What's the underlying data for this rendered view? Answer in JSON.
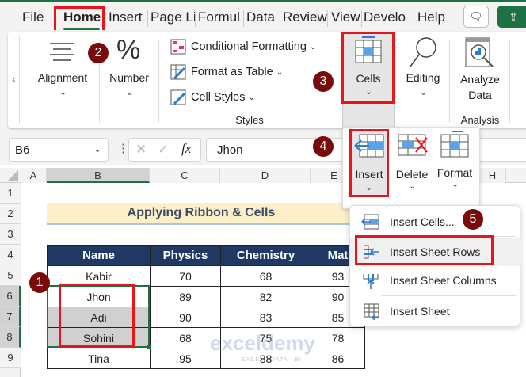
{
  "tabs": [
    "File",
    "Home",
    "Insert",
    "Page Li",
    "Formul",
    "Data",
    "Review",
    "View",
    "Develo",
    "Help"
  ],
  "ribbon": {
    "alignment": "Alignment",
    "number": "Number",
    "conditional_formatting": "Conditional Formatting",
    "format_as_table": "Format as Table",
    "cell_styles": "Cell Styles",
    "styles_group": "Styles",
    "cells": "Cells",
    "editing": "Editing",
    "analyze_data": "Analyze",
    "analyze_data2": "Data",
    "analysis_group": "Analysis",
    "scroll_left": "‹"
  },
  "formula_bar": {
    "name_box": "B6",
    "formula": "Jhon",
    "fx": "fx"
  },
  "columns": [
    "A",
    "B",
    "C",
    "D",
    "E",
    "H"
  ],
  "rows": [
    "1",
    "2",
    "3",
    "4",
    "5",
    "6",
    "7",
    "8",
    "9"
  ],
  "title": "Applying Ribbon & Cells",
  "table": {
    "headers": [
      "Name",
      "Physics",
      "Chemistry",
      "Mat"
    ],
    "rows": [
      [
        "Kabir",
        "70",
        "68",
        "93"
      ],
      [
        "Jhon",
        "89",
        "82",
        "90"
      ],
      [
        "Adi",
        "90",
        "83",
        "85"
      ],
      [
        "Sohini",
        "68",
        "75",
        "78"
      ],
      [
        "Tina",
        "95",
        "88",
        "86"
      ]
    ]
  },
  "cells_panel": {
    "insert": "Insert",
    "delete": "Delete",
    "format": "Format"
  },
  "insert_menu": [
    "Insert Cells...",
    "Insert Sheet Rows",
    "Insert Sheet Columns",
    "Insert Sheet"
  ],
  "badges": [
    "1",
    "2",
    "3",
    "4",
    "5"
  ],
  "watermark": "exceldemy",
  "watermark_sub": "EXCEL · DATA · BI",
  "colors": {
    "accent": "#1e7145",
    "header": "#1f3864",
    "badge": "#7a0b0b",
    "highlight": "#e8141b"
  }
}
